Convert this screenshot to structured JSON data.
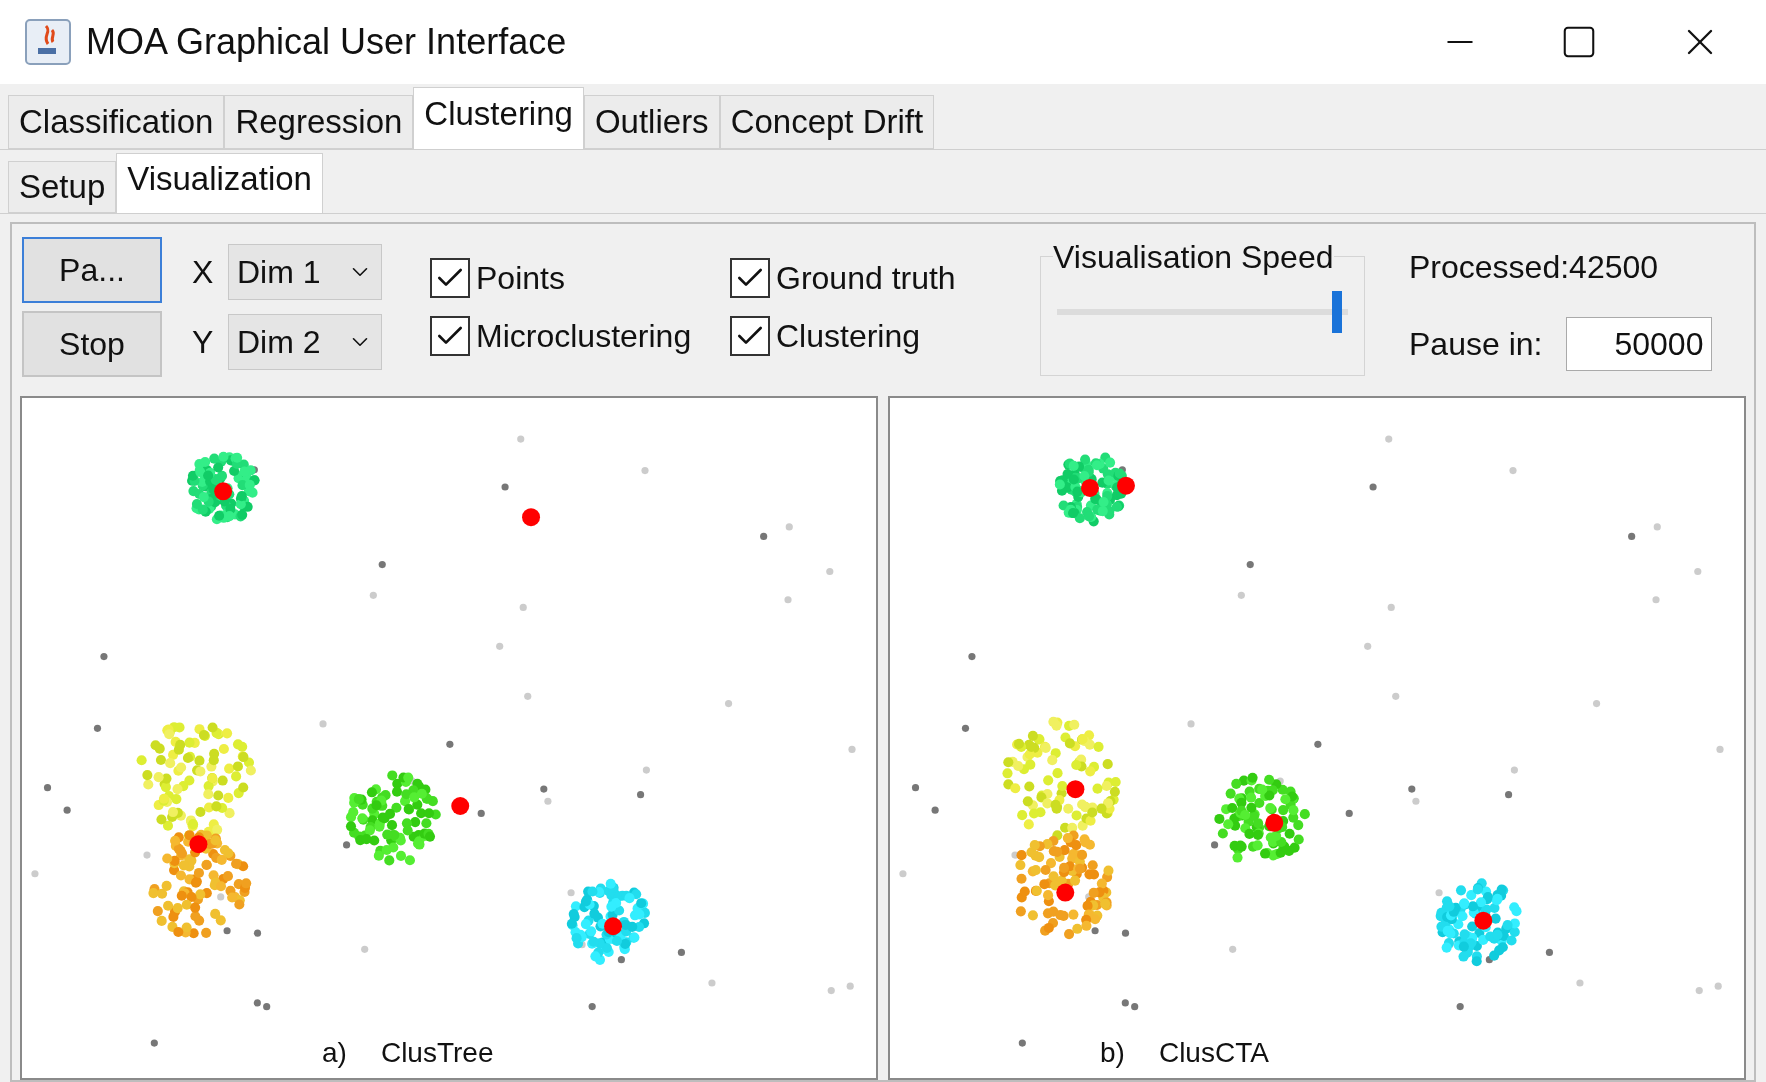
{
  "window": {
    "title": "MOA Graphical User Interface"
  },
  "tabs": [
    {
      "label": "Classification",
      "selected": false
    },
    {
      "label": "Regression",
      "selected": false
    },
    {
      "label": "Clustering",
      "selected": true
    },
    {
      "label": "Outliers",
      "selected": false
    },
    {
      "label": "Concept Drift",
      "selected": false
    }
  ],
  "subtabs": [
    {
      "label": "Setup",
      "selected": false
    },
    {
      "label": "Visualization",
      "selected": true
    }
  ],
  "buttons": [
    {
      "label": "Pa...",
      "focused": true
    },
    {
      "label": "Stop",
      "focused": false
    }
  ],
  "axes": [
    {
      "axis": "X",
      "value": "Dim 1"
    },
    {
      "axis": "Y",
      "value": "Dim 2"
    }
  ],
  "checkboxes": [
    {
      "label": "Points",
      "checked": true
    },
    {
      "label": "Ground truth",
      "checked": true
    },
    {
      "label": "Microclustering",
      "checked": true
    },
    {
      "label": "Clustering",
      "checked": true
    }
  ],
  "speed": {
    "title": "Visualisation Speed",
    "level": 0.98
  },
  "processed": "Processed:42500",
  "pause": {
    "label": "Pause in:",
    "value": "50000"
  },
  "panels": [
    {
      "label": "a)",
      "name": "ClusTree"
    },
    {
      "label": "b)",
      "name": "ClusCTA"
    }
  ]
}
